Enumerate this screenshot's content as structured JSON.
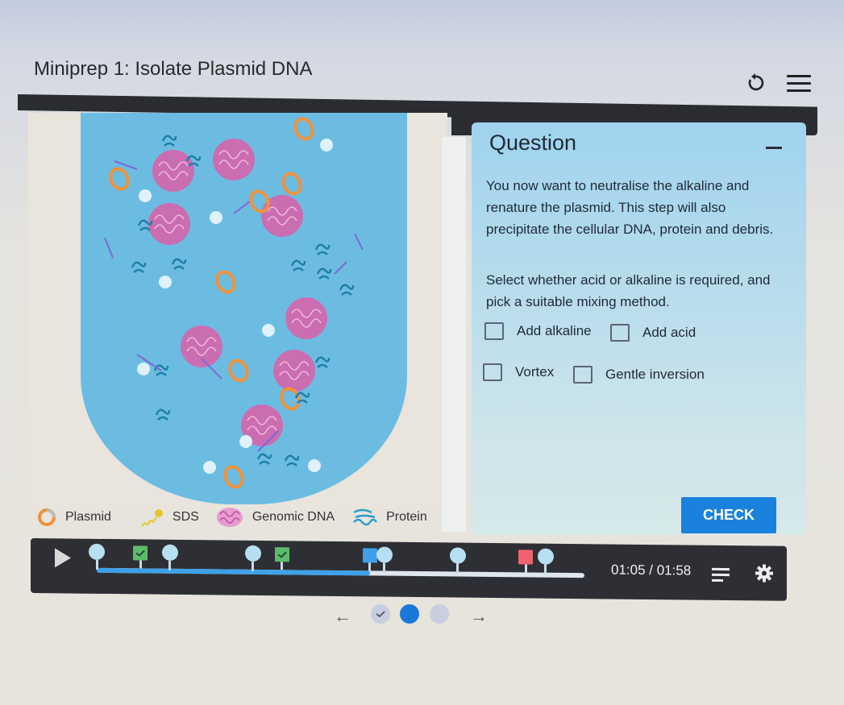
{
  "header": {
    "title": "Miniprep 1: Isolate Plasmid DNA",
    "icons": [
      "reset-icon",
      "menu-icon"
    ]
  },
  "legend": {
    "items": [
      {
        "label": "Plasmid",
        "icon": "plasmid-icon",
        "color": "#f0923c"
      },
      {
        "label": "SDS",
        "icon": "sds-icon",
        "color": "#e6c62a"
      },
      {
        "label": "Genomic DNA",
        "icon": "genomic-dna-icon",
        "color": "#d65fa8"
      },
      {
        "label": "Protein",
        "icon": "protein-icon",
        "color": "#2a9cc8"
      }
    ]
  },
  "question": {
    "heading": "Question",
    "paragraph1": "You now want to neutralise the alkaline and renature the plasmid. This step will also precipitate the cellular DNA, protein and debris.",
    "paragraph2": "Select whether acid or alkaline is required, and pick a suitable mixing method.",
    "options": [
      {
        "label": "Add alkaline",
        "checked": false
      },
      {
        "label": "Add acid",
        "checked": false
      },
      {
        "label": "Vortex",
        "checked": false
      },
      {
        "label": "Gentle inversion",
        "checked": false
      }
    ],
    "check_label": "CHECK"
  },
  "player": {
    "time": "01:05 / 01:58",
    "progress_percent": 56,
    "markers": [
      {
        "type": "circle",
        "position_percent": 0
      },
      {
        "type": "done",
        "position_percent": 9
      },
      {
        "type": "circle",
        "position_percent": 15
      },
      {
        "type": "circle",
        "position_percent": 32
      },
      {
        "type": "done",
        "position_percent": 38
      },
      {
        "type": "current",
        "position_percent": 56
      },
      {
        "type": "circle",
        "position_percent": 59
      },
      {
        "type": "circle",
        "position_percent": 74
      },
      {
        "type": "error",
        "position_percent": 88
      },
      {
        "type": "circle",
        "position_percent": 92
      }
    ],
    "colors": {
      "progress": "#3fa0e8",
      "done": "#5dbb6b",
      "current": "#3fa0e8",
      "error": "#f06273"
    }
  },
  "pagination": {
    "prev_label": "←",
    "next_label": "→",
    "dots": [
      {
        "state": "completed"
      },
      {
        "state": "active"
      },
      {
        "state": "upcoming"
      }
    ]
  }
}
